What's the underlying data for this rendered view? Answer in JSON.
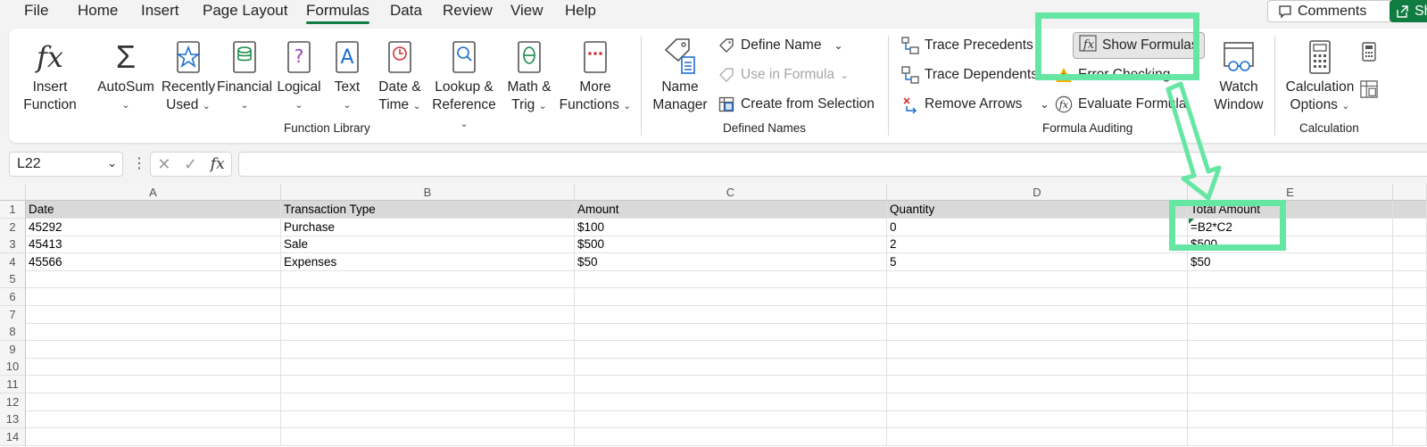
{
  "menu": {
    "tabs": [
      "File",
      "Home",
      "Insert",
      "Page Layout",
      "Formulas",
      "Data",
      "Review",
      "View",
      "Help"
    ],
    "active_tab": "Formulas",
    "comments_label": "Comments",
    "share_label": "Sh"
  },
  "ribbon": {
    "function_library": {
      "label": "Function Library",
      "insert_function": [
        "Insert",
        "Function"
      ],
      "autosum": "AutoSum",
      "recently_used": [
        "Recently",
        "Used"
      ],
      "financial": "Financial",
      "logical": "Logical",
      "text": "Text",
      "date_time": [
        "Date &",
        "Time"
      ],
      "lookup_reference": [
        "Lookup &",
        "Reference"
      ],
      "math_trig": [
        "Math &",
        "Trig"
      ],
      "more_functions": [
        "More",
        "Functions"
      ]
    },
    "defined_names": {
      "label": "Defined Names",
      "name_manager": [
        "Name",
        "Manager"
      ],
      "define_name": "Define Name",
      "use_in_formula": "Use in Formula",
      "create_from_selection": "Create from Selection"
    },
    "formula_auditing": {
      "label": "Formula Auditing",
      "trace_precedents": "Trace Precedents",
      "trace_dependents": "Trace Dependents",
      "remove_arrows": "Remove Arrows",
      "show_formulas": "Show Formulas",
      "error_checking": "Error Checking",
      "evaluate_formula": "Evaluate Formula",
      "watch_window": [
        "Watch",
        "Window"
      ]
    },
    "calculation": {
      "label": "Calculation",
      "calculation_options": [
        "Calculation",
        "Options"
      ]
    }
  },
  "formula_bar": {
    "name_box": "L22",
    "formula": ""
  },
  "sheet": {
    "columns": [
      "A",
      "B",
      "C",
      "D",
      "E"
    ],
    "row_numbers": [
      "1",
      "2",
      "3",
      "4",
      "5",
      "6",
      "7",
      "8",
      "9",
      "10",
      "11",
      "12",
      "13",
      "14"
    ],
    "rows": [
      [
        "Date",
        "Transaction Type",
        "Amount",
        "Quantity",
        "Total Amount"
      ],
      [
        "45292",
        "Purchase",
        "$100",
        "0",
        "=B2*C2"
      ],
      [
        "45413",
        "Sale",
        "$500",
        "2",
        "$500"
      ],
      [
        "45566",
        "Expenses",
        "$50",
        "5",
        "$50"
      ]
    ]
  },
  "colors": {
    "accent": "#107c41",
    "annotation": "#66e6a3",
    "header_row": "#d9d9d9"
  }
}
